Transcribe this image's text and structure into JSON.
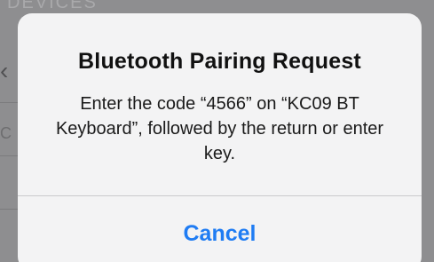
{
  "background": {
    "header_fragment": "DEVICES",
    "chevron_glyph": "‹",
    "row_fragment": "C"
  },
  "alert": {
    "title": "Bluetooth Pairing Request",
    "message": "Enter the code “4566” on “KC09 BT Keyboard”, followed by the return or enter key.",
    "cancel_label": "Cancel"
  },
  "colors": {
    "accent": "#1f7cf3",
    "dialog_bg": "#f3f3f4",
    "dim_bg": "#8e8e90"
  }
}
